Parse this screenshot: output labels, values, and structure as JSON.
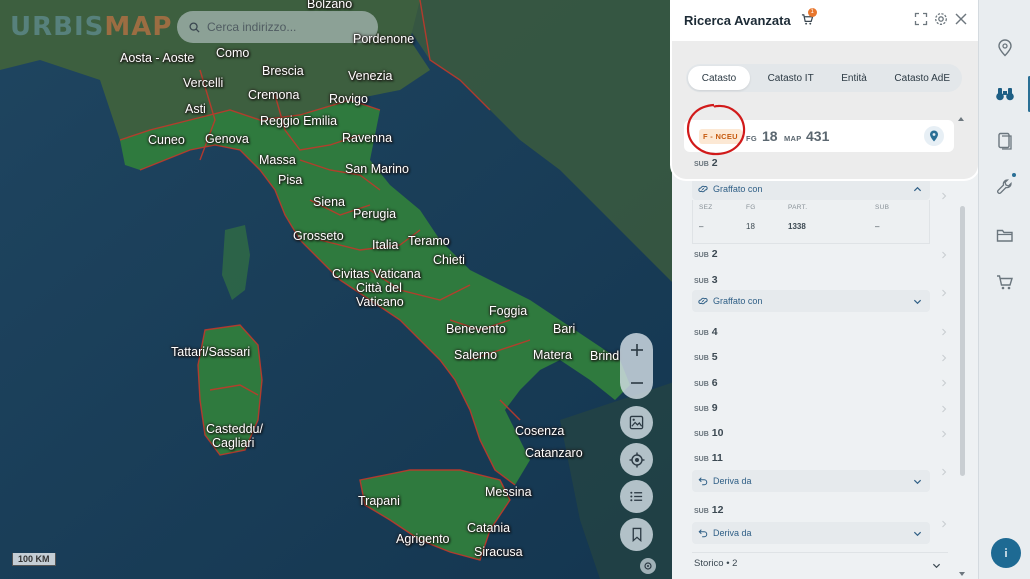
{
  "map": {
    "logo_part1": "URBIS",
    "logo_part2": "MAP",
    "search_placeholder": "Cerca indirizzo...",
    "scale_label": "100 KM",
    "cities": [
      {
        "name": "Bolzano",
        "id": "bolzano"
      },
      {
        "name": "Como",
        "id": "como"
      },
      {
        "name": "Pordenone",
        "id": "pordenone"
      },
      {
        "name": "Aosta - Aoste",
        "id": "aosta"
      },
      {
        "name": "Brescia",
        "id": "brescia"
      },
      {
        "name": "Venezia",
        "id": "venezia"
      },
      {
        "name": "Vercelli",
        "id": "vercelli"
      },
      {
        "name": "Cremona",
        "id": "cremona"
      },
      {
        "name": "Rovigo",
        "id": "rovigo"
      },
      {
        "name": "Asti",
        "id": "asti"
      },
      {
        "name": "Reggio Emilia",
        "id": "reggio-emilia"
      },
      {
        "name": "Ravenna",
        "id": "ravenna"
      },
      {
        "name": "Cuneo",
        "id": "cuneo"
      },
      {
        "name": "Genova",
        "id": "genova"
      },
      {
        "name": "Massa",
        "id": "massa"
      },
      {
        "name": "San Marino",
        "id": "san-marino"
      },
      {
        "name": "Pisa",
        "id": "pisa"
      },
      {
        "name": "Siena",
        "id": "siena"
      },
      {
        "name": "Perugia",
        "id": "perugia"
      },
      {
        "name": "Grosseto",
        "id": "grosseto"
      },
      {
        "name": "Italia",
        "id": "italia"
      },
      {
        "name": "Teramo",
        "id": "teramo"
      },
      {
        "name": "Chieti",
        "id": "chieti"
      },
      {
        "name": "Civitas Vaticana",
        "id": "civitas-vaticana"
      },
      {
        "name": "Città del",
        "id": "citta-del"
      },
      {
        "name": "Vaticano",
        "id": "vaticano"
      },
      {
        "name": "Foggia",
        "id": "foggia"
      },
      {
        "name": "Benevento",
        "id": "benevento"
      },
      {
        "name": "Bari",
        "id": "bari"
      },
      {
        "name": "Tattari/Sassari",
        "id": "sassari"
      },
      {
        "name": "Salerno",
        "id": "salerno"
      },
      {
        "name": "Matera",
        "id": "matera"
      },
      {
        "name": "Brind",
        "id": "brindisi"
      },
      {
        "name": "Casteddu/",
        "id": "casteddu"
      },
      {
        "name": "Cagliari",
        "id": "cagliari"
      },
      {
        "name": "Cosenza",
        "id": "cosenza"
      },
      {
        "name": "Catanzaro",
        "id": "catanzaro"
      },
      {
        "name": "Messina",
        "id": "messina"
      },
      {
        "name": "Trapani",
        "id": "trapani"
      },
      {
        "name": "Catania",
        "id": "catania"
      },
      {
        "name": "Agrigento",
        "id": "agrigento"
      },
      {
        "name": "Siracusa",
        "id": "siracusa"
      }
    ]
  },
  "panel": {
    "title": "Ricerca Avanzata",
    "cart_count": "1",
    "tabs": [
      "Catasto",
      "Catasto IT",
      "Entità",
      "Catasto AdE"
    ],
    "active_tab": "Catasto",
    "card": {
      "badge": "F - NCEU",
      "fg_label": "FG",
      "fg_value": "18",
      "map_label": "MAP",
      "map_value": "431",
      "sub_label": "SUB",
      "sub_value": "2"
    },
    "graffato_label": "Graffato con",
    "graffato_table": {
      "headers": [
        "SEZ",
        "FG",
        "PART.",
        "SUB"
      ],
      "values": [
        "–",
        "18",
        "1338",
        "–"
      ]
    },
    "subs": [
      {
        "label": "SUB",
        "value": "2"
      },
      {
        "label": "SUB",
        "value": "3"
      },
      {
        "label": "SUB",
        "value": "4"
      },
      {
        "label": "SUB",
        "value": "5"
      },
      {
        "label": "SUB",
        "value": "6"
      },
      {
        "label": "SUB",
        "value": "9"
      },
      {
        "label": "SUB",
        "value": "10"
      },
      {
        "label": "SUB",
        "value": "11"
      },
      {
        "label": "SUB",
        "value": "12"
      }
    ],
    "deriva_label": "Deriva da",
    "storico_label": "Storico • 2"
  },
  "colors": {
    "accent": "#2a6f95",
    "badge_text": "#c65a0f",
    "badge_bg": "#fce8d4",
    "highlight_circle": "#d11a1a",
    "map_land": "#2f7a3e",
    "map_border": "#c0392b"
  }
}
